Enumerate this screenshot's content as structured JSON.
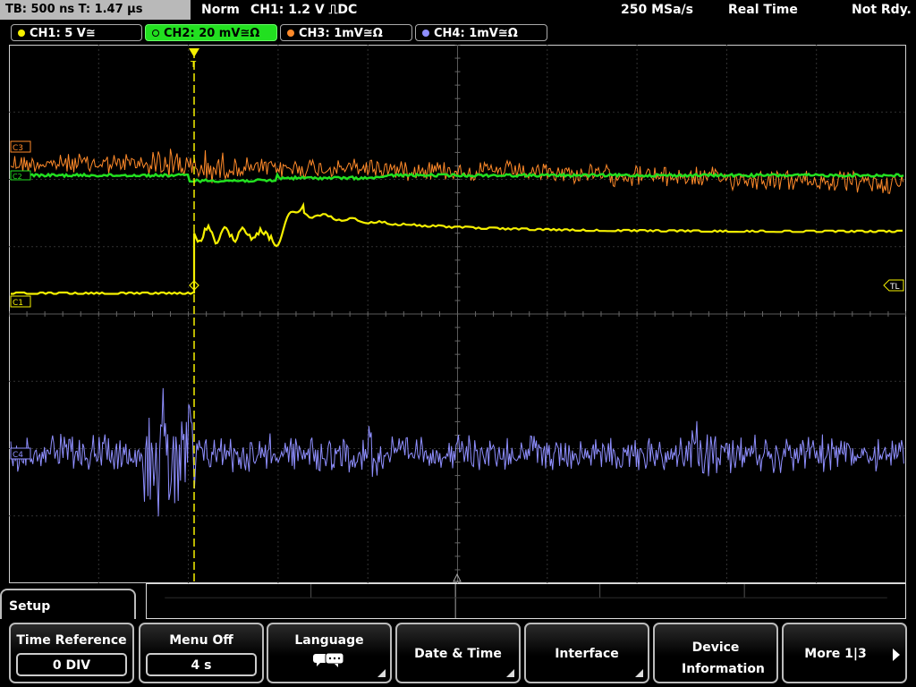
{
  "status": {
    "timebase": "TB: 500 ns  T: 1.47 µs",
    "mode": "Norm",
    "trigger": "CH1: 1.2 V ⎍DC",
    "sample_rate": "250 MSa/s",
    "acq_mode": "Real Time",
    "state": "Not Rdy."
  },
  "channels": [
    {
      "label": "CH1: 5 V≅",
      "color": "#f5f000"
    },
    {
      "label": "CH2: 20 mV≅Ω",
      "color": "#22e020"
    },
    {
      "label": "CH3: 1mV≅Ω",
      "color": "#ff8a2a"
    },
    {
      "label": "CH4: 1mV≅Ω",
      "color": "#8f8fff"
    }
  ],
  "markers": {
    "c3": "C3",
    "c2": "C2",
    "c1": "C1",
    "c4": "C4",
    "trigger_level": "TL"
  },
  "menu": {
    "title": "Setup",
    "keys": [
      {
        "label": "Time Reference",
        "value": "0 DIV"
      },
      {
        "label": "Menu Off",
        "value": "4 s"
      },
      {
        "label": "Language",
        "icon": "speech-bubble-icon"
      },
      {
        "label": "Date & Time"
      },
      {
        "label": "Interface"
      },
      {
        "label": "Device Information"
      },
      {
        "label": "More 1|3"
      }
    ]
  }
}
